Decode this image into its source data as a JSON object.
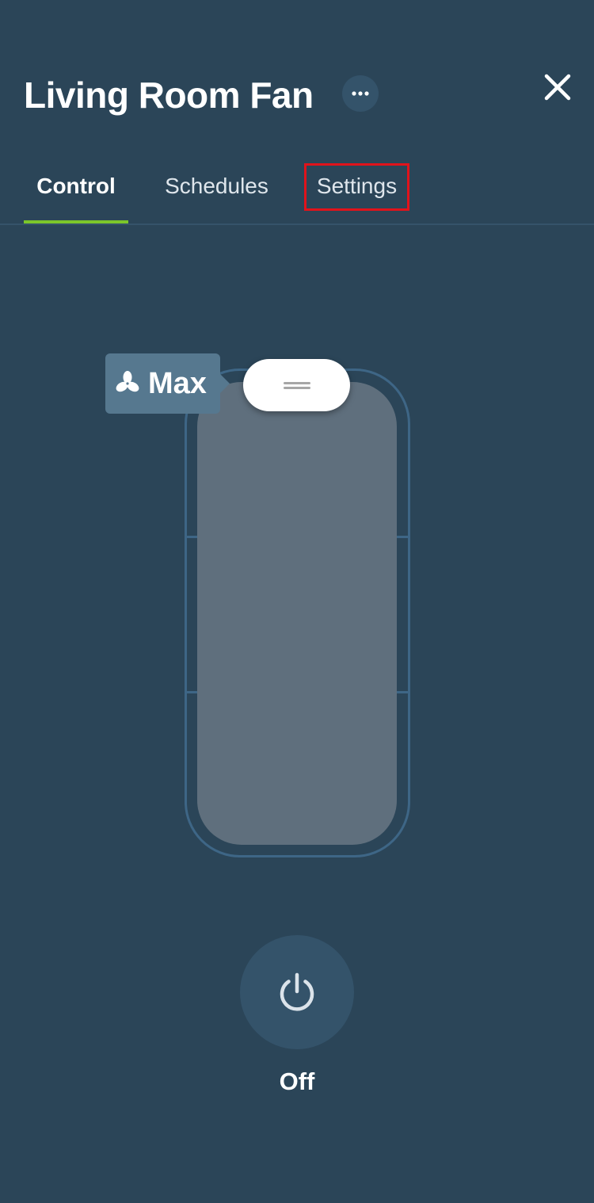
{
  "header": {
    "title": "Living Room Fan",
    "more_icon": "more-horizontal-icon",
    "close_icon": "close-icon"
  },
  "tabs": [
    {
      "label": "Control",
      "active": true
    },
    {
      "label": "Schedules",
      "active": false
    },
    {
      "label": "Settings",
      "active": false,
      "highlighted": true
    }
  ],
  "fan": {
    "level_label": "Max",
    "level_icon": "fan-icon",
    "level_fraction": 1.0,
    "speed_steps": 3
  },
  "power": {
    "icon": "power-icon",
    "label": "Off"
  },
  "colors": {
    "background": "#2b4558",
    "active_tab_indicator": "#7cc62a",
    "highlight_box": "#e1131b",
    "slider_fill": "#5f6f7d",
    "tooltip": "#56788f"
  }
}
